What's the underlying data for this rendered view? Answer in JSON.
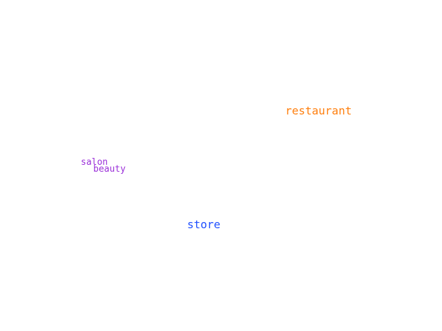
{
  "words": [
    {
      "text": "restaurant",
      "color": "#ff7f0e"
    },
    {
      "text": "salon",
      "color": "#9b30d9"
    },
    {
      "text": "beauty",
      "color": "#9b30d9"
    },
    {
      "text": "store",
      "color": "#1f4fff"
    }
  ]
}
